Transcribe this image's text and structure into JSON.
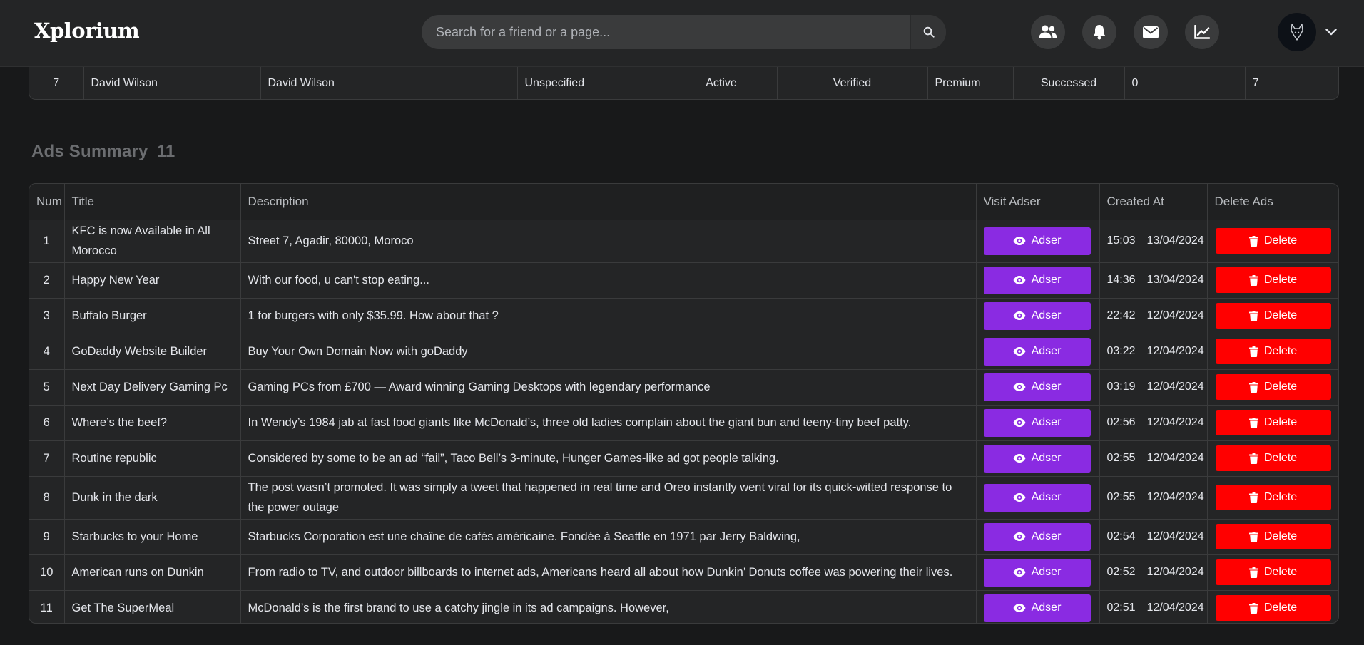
{
  "brand": {
    "logo": "Xplorium"
  },
  "search": {
    "placeholder": "Search for a friend or a page..."
  },
  "header_icons": [
    "friends-icon",
    "bell-icon",
    "mail-icon",
    "chart-icon"
  ],
  "users_row": {
    "num": "7",
    "username": "David Wilson",
    "fullname": "David Wilson",
    "gender": "Unspecified",
    "status": "Active",
    "verification": "Verified",
    "plan": "Premium",
    "payment": "Successed",
    "count_a": "0",
    "count_b": "7"
  },
  "ads_section": {
    "title": "Ads Summary",
    "count": "11"
  },
  "ads_table": {
    "headers": {
      "num": "Num",
      "title": "Title",
      "description": "Description",
      "visit": "Visit Adser",
      "created": "Created At",
      "delete": "Delete Ads"
    },
    "adser_label": "Adser",
    "delete_label": "Delete",
    "rows": [
      {
        "num": "1",
        "title": "KFC is now Available in All Morocco",
        "description": "Street 7, Agadir, 80000, Moroco",
        "time": "15:03",
        "date": "13/04/2024"
      },
      {
        "num": "2",
        "title": "Happy New Year",
        "description": "With our food, u can't stop eating...",
        "time": "14:36",
        "date": "13/04/2024"
      },
      {
        "num": "3",
        "title": "Buffalo Burger",
        "description": "1 for burgers with only $35.99. How about that ?",
        "time": "22:42",
        "date": "12/04/2024"
      },
      {
        "num": "4",
        "title": "GoDaddy Website Builder",
        "description": "Buy Your Own Domain Now with goDaddy",
        "time": "03:22",
        "date": "12/04/2024"
      },
      {
        "num": "5",
        "title": "Next Day Delivery Gaming Pc",
        "description": "Gaming PCs from £700 — Award winning Gaming Desktops with legendary performance",
        "time": "03:19",
        "date": "12/04/2024"
      },
      {
        "num": "6",
        "title": "Where’s the beef?",
        "description": "In Wendy’s 1984 jab at fast food giants like McDonald’s, three old ladies complain about the giant bun and teeny-tiny beef patty.",
        "time": "02:56",
        "date": "12/04/2024"
      },
      {
        "num": "7",
        "title": "Routine republic",
        "description": "Considered by some to be an ad “fail”, Taco Bell’s 3-minute, Hunger Games-like ad got people talking.",
        "time": "02:55",
        "date": "12/04/2024"
      },
      {
        "num": "8",
        "title": "Dunk in the dark",
        "description": "The post wasn’t promoted. It was simply a tweet that happened in real time and Oreo instantly went viral for its quick-witted response to the power outage",
        "time": "02:55",
        "date": "12/04/2024"
      },
      {
        "num": "9",
        "title": "Starbucks to your Home",
        "description": "Starbucks Corporation est une chaîne de cafés américaine. Fondée à Seattle en 1971 par Jerry Baldwing,",
        "time": "02:54",
        "date": "12/04/2024"
      },
      {
        "num": "10",
        "title": "American runs on Dunkin",
        "description": "From radio to TV, and outdoor billboards to internet ads, Americans heard all about how Dunkin’ Donuts coffee was powering their lives.",
        "time": "02:52",
        "date": "12/04/2024"
      },
      {
        "num": "11",
        "title": "Get The SuperMeal",
        "description": "McDonald’s is the first brand to use a catchy jingle in its ad campaigns. However,",
        "time": "02:51",
        "date": "12/04/2024"
      }
    ]
  },
  "colors": {
    "accent_purple": "#8a2be2",
    "danger_red": "#ff0000",
    "success_green": "#31c82f"
  }
}
